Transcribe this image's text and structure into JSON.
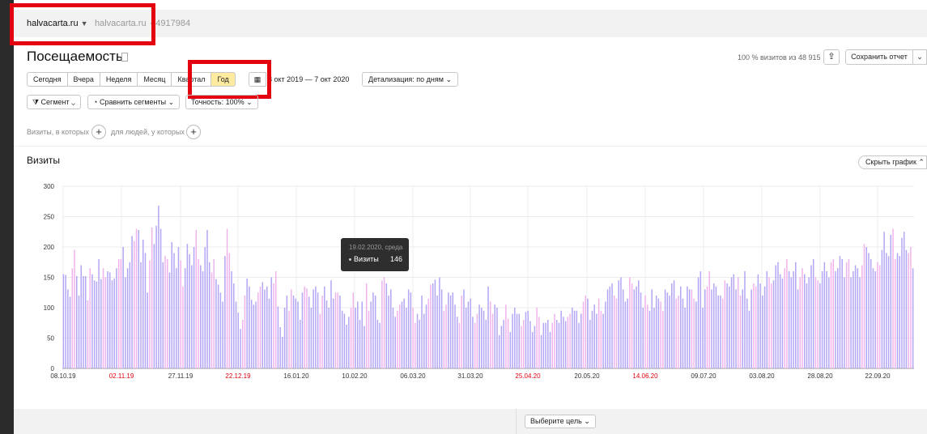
{
  "header": {
    "site": "halvacarta.ru",
    "site_secondary": "halvacarta.ru",
    "separator": "·",
    "counter_id": "4917984"
  },
  "page": {
    "title": "Посещаемость",
    "visits_pct": "100 % визитов из 48 915",
    "save_label": "Сохранить отчет"
  },
  "period": {
    "buttons": [
      "Сегодня",
      "Вчера",
      "Неделя",
      "Месяц",
      "Квартал",
      "Год"
    ],
    "active": "Год",
    "date_range": "8 окт 2019 — 7 окт 2020",
    "detail": "Детализация: по дням"
  },
  "segments": {
    "segment": "Сегмент",
    "compare": "Сравнить сегменты",
    "accuracy": "Точность: 100%"
  },
  "filters": {
    "visits_who": "Визиты, в которых",
    "people_who": "для людей, у которых"
  },
  "section": {
    "title": "Визиты",
    "hide_chart": "Скрыть график"
  },
  "tooltip": {
    "date": "19.02.2020, среда",
    "series": "Визиты",
    "value": "146"
  },
  "goal": {
    "label": "Выберите цель"
  },
  "colors": {
    "bar_weekday": "#b3a6f5",
    "bar_weekend": "#f0b4ec",
    "highlight": "#e3000f",
    "active_period": "#ffeba0"
  },
  "chart_data": {
    "type": "bar",
    "ylim": [
      0,
      300
    ],
    "yticks": [
      0,
      50,
      100,
      150,
      200,
      250,
      300
    ],
    "xticks": [
      {
        "label": "08.10.19",
        "weekend": false
      },
      {
        "label": "02.11.19",
        "weekend": true
      },
      {
        "label": "27.11.19",
        "weekend": false
      },
      {
        "label": "22.12.19",
        "weekend": true
      },
      {
        "label": "16.01.20",
        "weekend": false
      },
      {
        "label": "10.02.20",
        "weekend": false
      },
      {
        "label": "06.03.20",
        "weekend": false
      },
      {
        "label": "31.03.20",
        "weekend": false
      },
      {
        "label": "25.04.20",
        "weekend": true
      },
      {
        "label": "20.05.20",
        "weekend": false
      },
      {
        "label": "14.06.20",
        "weekend": true
      },
      {
        "label": "09.07.20",
        "weekend": false
      },
      {
        "label": "03.08.20",
        "weekend": false
      },
      {
        "label": "28.08.20",
        "weekend": false
      },
      {
        "label": "22.09.20",
        "weekend": false
      }
    ],
    "series": [
      {
        "name": "Визиты",
        "values": [
          155,
          154,
          130,
          118,
          165,
          195,
          152,
          120,
          170,
          152,
          152,
          112,
          165,
          155,
          145,
          143,
          180,
          147,
          165,
          150,
          160,
          158,
          145,
          148,
          165,
          180,
          180,
          200,
          150,
          165,
          175,
          218,
          210,
          230,
          228,
          175,
          212,
          190,
          125,
          178,
          232,
          205,
          235,
          268,
          230,
          175,
          185,
          180,
          158,
          208,
          190,
          165,
          200,
          178,
          135,
          165,
          205,
          188,
          170,
          200,
          228,
          180,
          170,
          160,
          200,
          228,
          175,
          158,
          180,
          147,
          138,
          125,
          110,
          185,
          230,
          190,
          160,
          140,
          110,
          92,
          65,
          80,
          120,
          148,
          135,
          113,
          105,
          110,
          125,
          135,
          142,
          130,
          135,
          115,
          150,
          140,
          160,
          102,
          68,
          52,
          100,
          120,
          95,
          130,
          120,
          115,
          110,
          80,
          125,
          135,
          132,
          118,
          100,
          130,
          135,
          125,
          90,
          120,
          135,
          112,
          100,
          145,
          115,
          125,
          125,
          120,
          95,
          90,
          72,
          85,
          100,
          125,
          100,
          110,
          80,
          110,
          70,
          140,
          95,
          110,
          125,
          120,
          80,
          75,
          145,
          150,
          140,
          120,
          130,
          100,
          85,
          95,
          105,
          110,
          115,
          100,
          130,
          125,
          100,
          75,
          90,
          80,
          120,
          90,
          105,
          115,
          138,
          140,
          146,
          120,
          150,
          130,
          95,
          105,
          125,
          120,
          125,
          105,
          85,
          75,
          120,
          130,
          100,
          110,
          115,
          85,
          75,
          90,
          105,
          100,
          95,
          80,
          135,
          110,
          90,
          105,
          100,
          55,
          70,
          80,
          105,
          82,
          60,
          90,
          100,
          90,
          90,
          70,
          80,
          93,
          95,
          78,
          60,
          70,
          100,
          85,
          55,
          75,
          75,
          80,
          60,
          75,
          90,
          80,
          75,
          95,
          85,
          78,
          85,
          90,
          100,
          95,
          95,
          75,
          90,
          110,
          120,
          115,
          80,
          95,
          105,
          90,
          115,
          95,
          90,
          110,
          130,
          135,
          140,
          120,
          115,
          145,
          150,
          130,
          110,
          115,
          150,
          140,
          130,
          135,
          145,
          125,
          100,
          120,
          105,
          95,
          130,
          100,
          120,
          115,
          110,
          95,
          130,
          125,
          120,
          140,
          145,
          115,
          120,
          135,
          115,
          100,
          135,
          130,
          130,
          115,
          110,
          150,
          160,
          100,
          130,
          135,
          160,
          130,
          140,
          135,
          120,
          120,
          115,
          145,
          140,
          135,
          150,
          155,
          130,
          150,
          120,
          130,
          160,
          115,
          95,
          130,
          140,
          135,
          155,
          140,
          120,
          135,
          160,
          150,
          140,
          145,
          170,
          175,
          155,
          148,
          165,
          180,
          160,
          150,
          160,
          175,
          130,
          150,
          165,
          155,
          140,
          150,
          170,
          180,
          150,
          145,
          140,
          160,
          175,
          160,
          150,
          175,
          180,
          160,
          165,
          185,
          180,
          150,
          175,
          180,
          150,
          160,
          170,
          165,
          150,
          170,
          205,
          200,
          190,
          180,
          165,
          160,
          175,
          170,
          195,
          225,
          190,
          185,
          220,
          230,
          180,
          190,
          185,
          215,
          225,
          195,
          190,
          200,
          165
        ]
      }
    ]
  }
}
